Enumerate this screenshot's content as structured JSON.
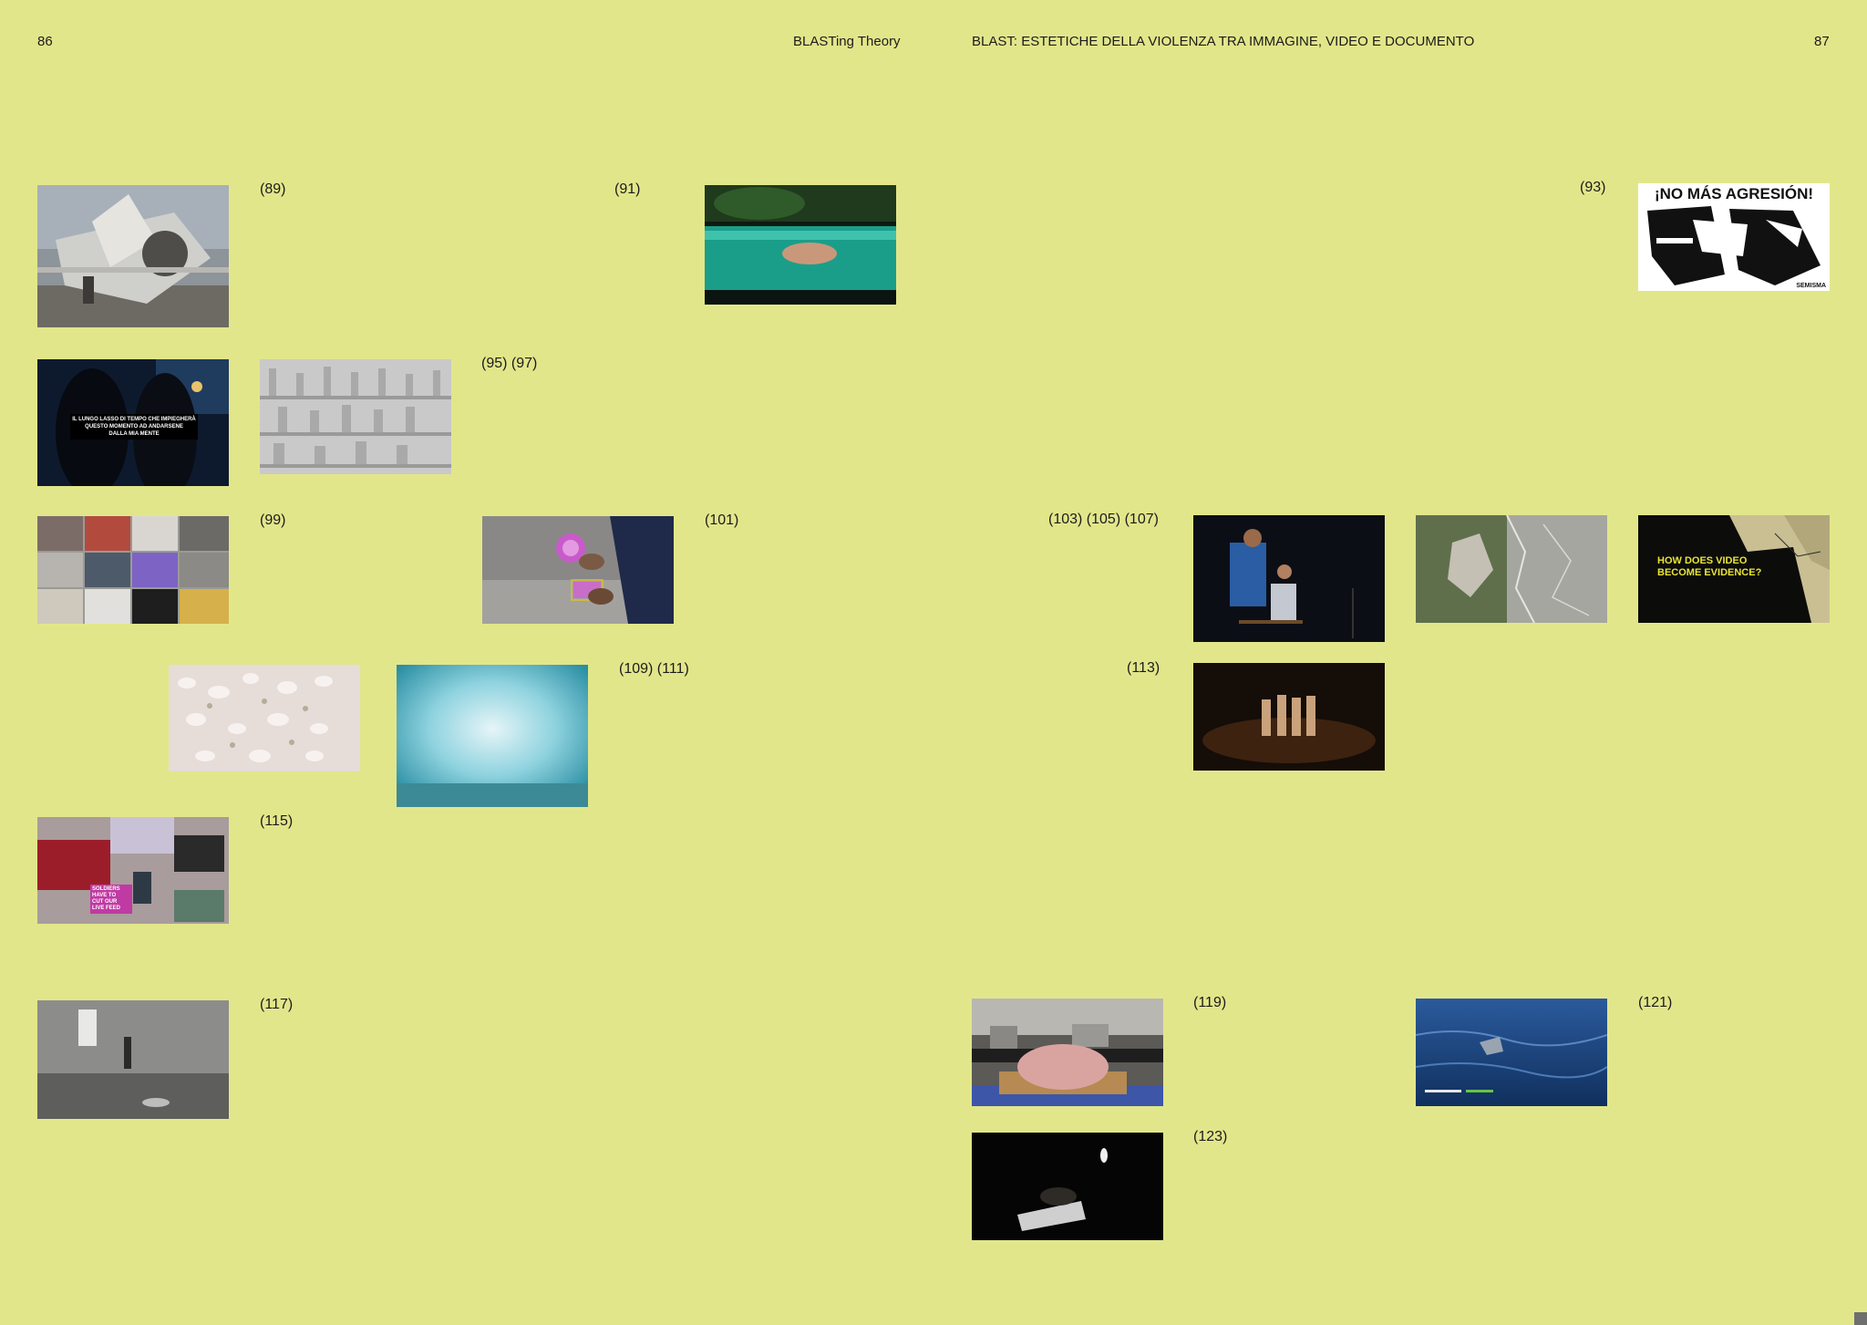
{
  "header": {
    "left_page_number": "86",
    "left_running_title": "BLASTing Theory",
    "right_running_title": "BLAST: ESTETICHE DELLA VIOLENZA TRA IMMAGINE, VIDEO E DOCUMENTO",
    "right_page_number": "87"
  },
  "figure_labels": {
    "l89": "(89)",
    "l91": "(91)",
    "l93": "(93)",
    "l95_97": "(95) (97)",
    "l99": "(99)",
    "l101": "(101)",
    "l103_105_107": "(103) (105) (107)",
    "l109_111": "(109) (111)",
    "l113": "(113)",
    "l115": "(115)",
    "l117": "(117)",
    "l119": "(119)",
    "l121": "(121)",
    "l123": "(123)"
  },
  "image_texts": {
    "poster_headline": "¡NO MÁS AGRESIÓN!",
    "poster_credit": "SEMISMA",
    "caption_line_1": "IL LUNGO LASSO DI TEMPO CHE IMPIEGHERÀ",
    "caption_line_2": "QUESTO MOMENTO AD ANDARSENE",
    "caption_line_3": "DALLA MIA MENTE",
    "evidence_line_1": "HOW DOES VIDEO",
    "evidence_line_2": "BECOME EVIDENCE?",
    "collage_line_1": "SOLDIERS",
    "collage_line_2": "HAVE TO",
    "collage_line_3": "CUT OUR",
    "collage_line_4": "LIVE FEED"
  }
}
